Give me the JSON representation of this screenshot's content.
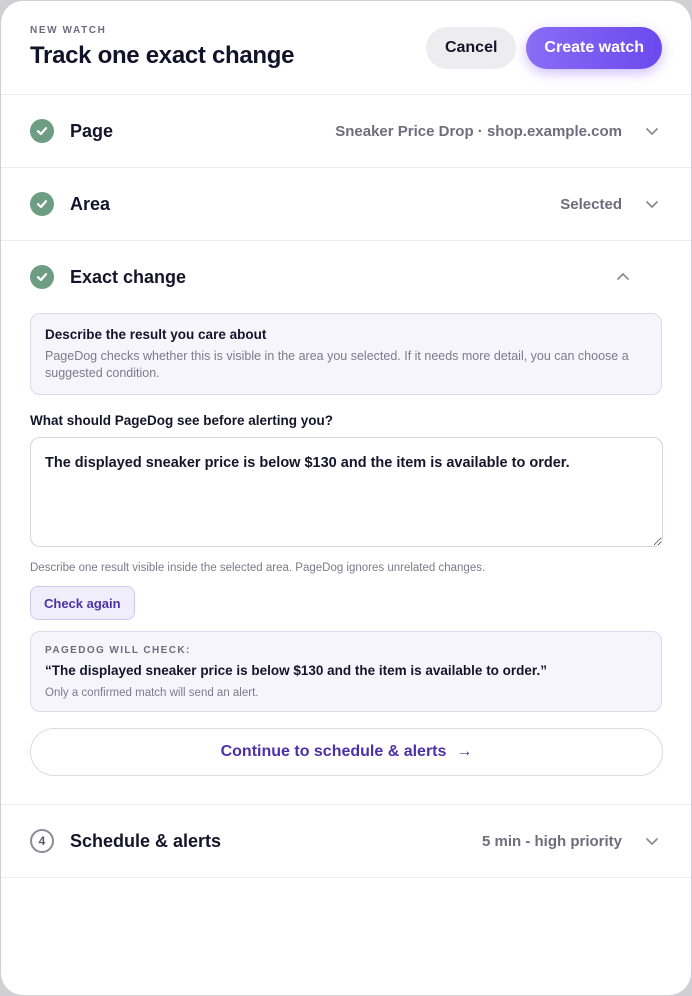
{
  "header": {
    "eyebrow": "NEW WATCH",
    "title": "Track one exact change",
    "cancel_label": "Cancel",
    "create_label": "Create watch"
  },
  "steps": [
    {
      "label": "Page",
      "summary": "Sneaker Price Drop · shop.example.com",
      "status": "done"
    },
    {
      "label": "Area",
      "summary": "Selected",
      "status": "done"
    },
    {
      "label": "Exact change",
      "summary": "",
      "status": "done"
    },
    {
      "label": "Schedule & alerts",
      "summary": "5 min - high priority",
      "status": "pending",
      "number": "4"
    }
  ],
  "exact_change": {
    "info_title": "Describe the result you care about",
    "info_text": "PageDog checks whether this is visible in the area you selected. If it needs more detail, you can choose a suggested condition.",
    "question": "What should PageDog see before alerting you?",
    "condition_value": "The displayed sneaker price is below $130 and the item is available to order.",
    "hint": "Describe one result visible inside the selected area. PageDog ignores unrelated changes.",
    "check_again_label": "Check again",
    "confirm_eyebrow": "PAGEDOG WILL CHECK:",
    "confirm_quote": "“The displayed sneaker price is below $130 and the item is available to order.”",
    "confirm_note": "Only a confirmed match will send an alert.",
    "continue_label": "Continue to schedule & alerts",
    "continue_arrow": "→"
  },
  "colors": {
    "accent": "#6c49ee",
    "check_green": "#6d9e83",
    "link_purple": "#4a33a8"
  },
  "icons": {
    "done": "check-icon",
    "collapse": "chevron-down-icon",
    "expand": "chevron-up-icon"
  }
}
